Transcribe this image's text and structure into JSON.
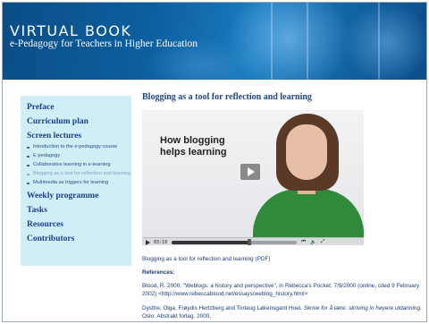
{
  "header": {
    "title": "VIRTUAL BOOK",
    "subtitle": "e-Pedagogy for Teachers in Higher Education"
  },
  "sidebar": {
    "items": [
      {
        "label": "Preface"
      },
      {
        "label": "Curriculum plan"
      },
      {
        "label": "Screen lectures"
      },
      {
        "label": "Weekly programme"
      },
      {
        "label": "Tasks"
      },
      {
        "label": "Resources"
      },
      {
        "label": "Contributors"
      }
    ],
    "screen_lectures": [
      {
        "label": "Introduction to the e-pedagogy course"
      },
      {
        "label": "E-pedagogy"
      },
      {
        "label": "Collaborative learning in e-learning"
      },
      {
        "label": "Blogging as a tool for reflection and learning",
        "active": true
      },
      {
        "label": "Multimedia as triggers for learning"
      }
    ]
  },
  "main": {
    "title": "Blogging as a tool for reflection and learning",
    "video": {
      "caption": "How blogging helps learning",
      "time": "03:19",
      "progress": 0.62
    },
    "pdf_link": "Blogging as a tool for reflection and learning (PDF)",
    "references_heading": "References:",
    "ref1": "Blood, R. 2000. \"Weblogs: a history and perspective\", in Rebecca's Pocket. 7/9/2000 (online, cited 9 February 2002) <http://www.rebeccablood.net/essays/weblog_history.html>",
    "ref2_plain": "Dysthe, Olga, Frøydis Hertzberg and Torlaug Løkensgard Hoel. ",
    "ref2_italic": "Skrive for å lære: skriving in høyere utdanning.",
    "ref2_tail": " Oslo: Abstrakt forlag. 2000."
  },
  "colors": {
    "banner": "#0d5f9f",
    "sidebar_bg": "#cfeef6",
    "link": "#1d3f8a",
    "inactive_link": "#8aa2bd"
  }
}
